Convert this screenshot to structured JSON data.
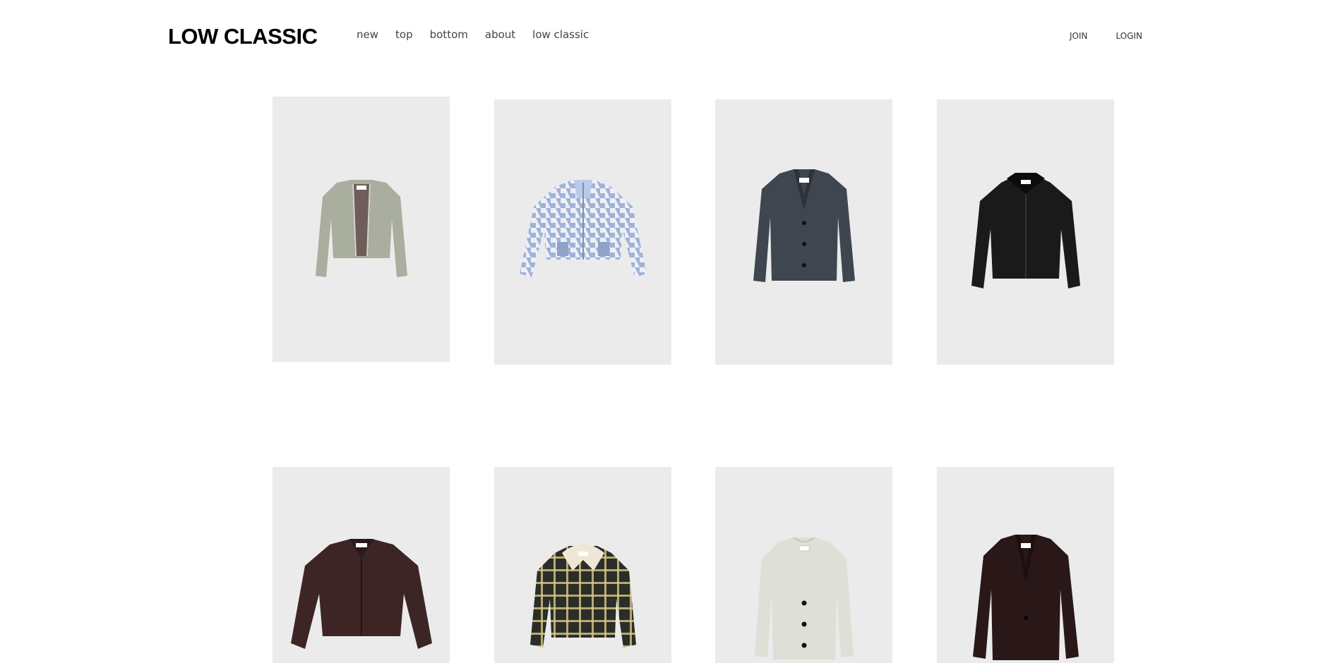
{
  "header": {
    "logo": "LOW CLASSIC",
    "nav": [
      "new",
      "top",
      "bottom",
      "about",
      "low classic"
    ],
    "util": [
      "JOIN",
      "LOGIN"
    ]
  },
  "products": [
    {
      "id": "tweed-cropped-jacket",
      "colors": {
        "body": "#a9ae9f",
        "lining": "#6e5d5a",
        "trim": "#d9d5c8"
      }
    },
    {
      "id": "houndstooth-zip-jacket",
      "colors": {
        "body": "#c8d2e6",
        "trim": "#8fa3c9"
      }
    },
    {
      "id": "grey-wool-blazer",
      "colors": {
        "body": "#3f4650"
      }
    },
    {
      "id": "black-leather-bomber",
      "colors": {
        "body": "#1a1a1a",
        "collar": "#0c0c0c"
      }
    },
    {
      "id": "brown-leather-jacket",
      "colors": {
        "body": "#3e2525"
      }
    },
    {
      "id": "check-shearling-collar-jacket",
      "colors": {
        "body": "#2b2e26",
        "check": "#d8c98a",
        "collar": "#efe7d6"
      }
    },
    {
      "id": "ivory-collarless-jacket",
      "colors": {
        "body": "#dedfd6"
      }
    },
    {
      "id": "dark-brown-blazer",
      "colors": {
        "body": "#2a1718"
      }
    }
  ]
}
